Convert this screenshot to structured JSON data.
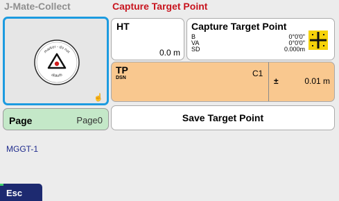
{
  "app": {
    "title": "J-Mate-Collect",
    "screen_title": "Capture Target Point"
  },
  "image_panel": {
    "marker_text_top": "marker - do not",
    "marker_text_left": "national survey",
    "marker_text_bottom": "disturb"
  },
  "page": {
    "label": "Page",
    "value": "Page0"
  },
  "job": {
    "name": "MGGT-1"
  },
  "ht": {
    "label": "HT",
    "value": "0.0 m"
  },
  "capture": {
    "title": "Capture Target Point",
    "rows": [
      {
        "label": "B",
        "value": "0°0'0\""
      },
      {
        "label": "VA",
        "value": "0°0'0\""
      },
      {
        "label": "SD",
        "value": "0.000m"
      }
    ],
    "icon": "target-crosshair-icon"
  },
  "tp": {
    "label": "TP",
    "sublabel": "DSN",
    "code": "C1",
    "tolerance_symbol": "±",
    "tolerance": "0.01 m"
  },
  "save_button": {
    "label": "Save Target Point"
  },
  "esc_button": {
    "label": "Esc"
  },
  "colors": {
    "accent_blue": "#1c9be0",
    "title_red": "#c8141e",
    "page_green": "#c4e8c8",
    "tp_orange": "#f9c88f",
    "esc_navy": "#1d2a70",
    "target_yellow": "#f5d20a"
  }
}
